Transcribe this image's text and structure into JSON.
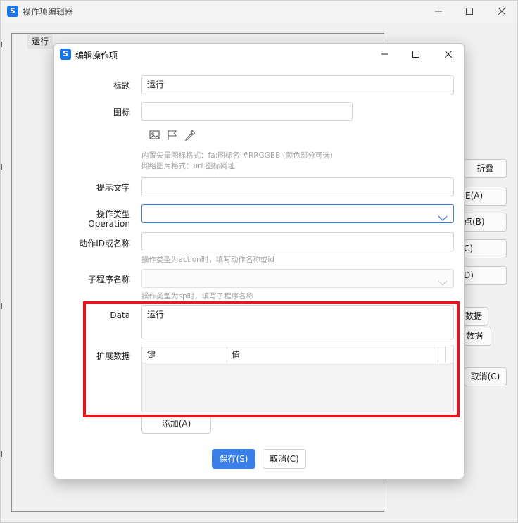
{
  "outer_window": {
    "title": "操作项编辑器",
    "tab_label": "运行",
    "buttons": {
      "fold": "折叠",
      "partial_a": "E(A)",
      "partial_b": "点(B)",
      "partial_c": "C)",
      "partial_d": "D)",
      "partial_data1": "数据",
      "partial_data2": "数据",
      "cancel": "取消(C)"
    }
  },
  "dialog": {
    "title": "编辑操作项",
    "fields": {
      "title": {
        "label": "标题",
        "value": "运行"
      },
      "icon": {
        "label": "图标",
        "value": "",
        "hint_lines": [
          "内置矢量图标格式：fa:图标名:#RRGGBB (颜色部分可选)",
          "网络图片格式：url:图标网址"
        ]
      },
      "tooltip": {
        "label": "提示文字",
        "value": ""
      },
      "operation_type": {
        "label_line1": "操作类型",
        "label_line2": "Operation",
        "value": ""
      },
      "action": {
        "label": "动作ID或名称",
        "value": "",
        "hint": "操作类型为action时，填写动作名称或id"
      },
      "subprogram": {
        "label": "子程序名称",
        "value": "",
        "hint": "操作类型为sp时，填写子程序名称"
      },
      "data": {
        "label": "Data",
        "value": "运行"
      },
      "ext": {
        "label": "扩展数据",
        "columns": [
          "键",
          "值"
        ],
        "rows": []
      }
    },
    "add_button": "添加(A)",
    "save_button": "保存(S)",
    "cancel_button": "取消(C)"
  },
  "colors": {
    "accent": "#3a7ee8",
    "highlight": "#e8141c",
    "hint_text": "#a2a2a2"
  },
  "icons": [
    "app-icon",
    "minimize-icon",
    "maximize-icon",
    "close-icon",
    "image-icon",
    "flag-icon",
    "eyedropper-icon",
    "chevron-down-icon"
  ]
}
